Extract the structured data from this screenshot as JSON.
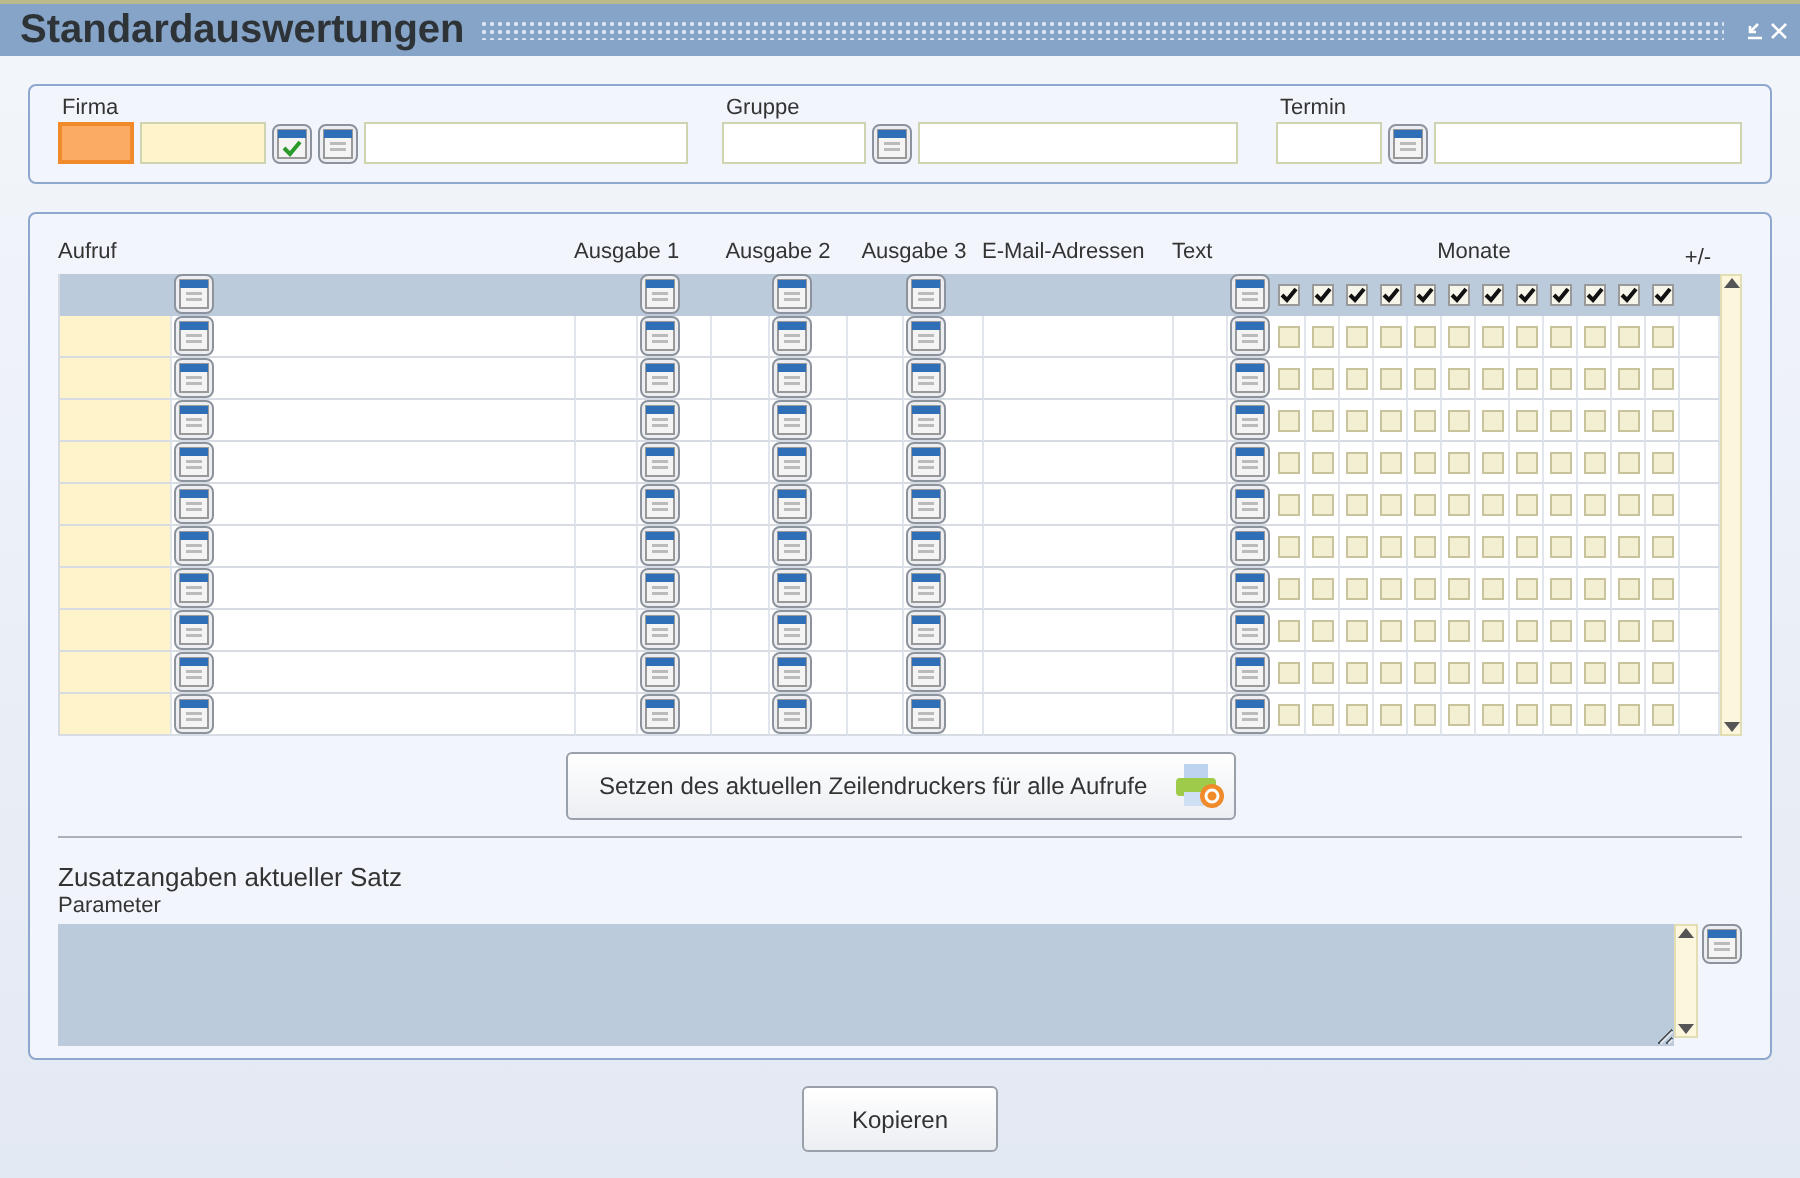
{
  "window": {
    "title": "Standardauswertungen"
  },
  "filters": [
    {
      "label": "Firma",
      "parts": [
        {
          "kind": "field",
          "focused": true,
          "required": true
        },
        {
          "kind": "field",
          "focused": false,
          "required": true
        },
        {
          "kind": "check_button"
        },
        {
          "kind": "lookup_button"
        },
        {
          "kind": "field",
          "focused": false,
          "required": false
        }
      ]
    },
    {
      "label": "Gruppe",
      "parts": [
        {
          "kind": "field",
          "focused": false,
          "required": false
        },
        {
          "kind": "lookup_button"
        },
        {
          "kind": "field",
          "focused": false,
          "required": false
        }
      ]
    },
    {
      "label": "Termin",
      "parts": [
        {
          "kind": "field",
          "focused": false,
          "required": false
        },
        {
          "kind": "lookup_button"
        },
        {
          "kind": "field",
          "focused": false,
          "required": false
        }
      ]
    }
  ],
  "table": {
    "columns": [
      "Aufruf",
      "Ausgabe 1",
      "Ausgabe 2",
      "Ausgabe 3",
      "E-Mail-Adressen",
      "Text",
      "Monate",
      "+/-"
    ],
    "header_row": {
      "months": [
        true,
        true,
        true,
        true,
        true,
        true,
        true,
        true,
        true,
        true,
        true,
        true
      ]
    },
    "rows": [
      {
        "months": [
          false,
          false,
          false,
          false,
          false,
          false,
          false,
          false,
          false,
          false,
          false,
          false
        ]
      },
      {
        "months": [
          false,
          false,
          false,
          false,
          false,
          false,
          false,
          false,
          false,
          false,
          false,
          false
        ]
      },
      {
        "months": [
          false,
          false,
          false,
          false,
          false,
          false,
          false,
          false,
          false,
          false,
          false,
          false
        ]
      },
      {
        "months": [
          false,
          false,
          false,
          false,
          false,
          false,
          false,
          false,
          false,
          false,
          false,
          false
        ]
      },
      {
        "months": [
          false,
          false,
          false,
          false,
          false,
          false,
          false,
          false,
          false,
          false,
          false,
          false
        ]
      },
      {
        "months": [
          false,
          false,
          false,
          false,
          false,
          false,
          false,
          false,
          false,
          false,
          false,
          false
        ]
      },
      {
        "months": [
          false,
          false,
          false,
          false,
          false,
          false,
          false,
          false,
          false,
          false,
          false,
          false
        ]
      },
      {
        "months": [
          false,
          false,
          false,
          false,
          false,
          false,
          false,
          false,
          false,
          false,
          false,
          false
        ]
      },
      {
        "months": [
          false,
          false,
          false,
          false,
          false,
          false,
          false,
          false,
          false,
          false,
          false,
          false
        ]
      },
      {
        "months": [
          false,
          false,
          false,
          false,
          false,
          false,
          false,
          false,
          false,
          false,
          false,
          false
        ]
      }
    ]
  },
  "printer_button": "Setzen des aktuellen Zeilendruckers für alle Aufrufe",
  "details": {
    "title": "Zusatzangaben aktueller Satz",
    "parameter_label": "Parameter"
  },
  "buttons": [
    "Kopieren"
  ]
}
